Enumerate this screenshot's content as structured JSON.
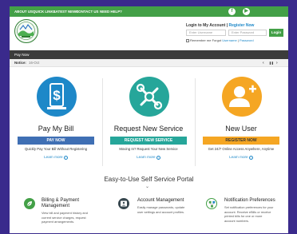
{
  "topnav": [
    "ABOUT US",
    "QUICK LINKS",
    "LATEST NEWS",
    "CONTACT US",
    "NEED HELP?"
  ],
  "social": [
    "f",
    "▶"
  ],
  "login": {
    "title": "Login to My Account",
    "sep": "|",
    "register": "Register Now",
    "username_placeholder": "Enter Username",
    "password_placeholder": "Enter Password",
    "button": "Login",
    "remember": "Remember me",
    "forgot_label": "Forgot",
    "forgot_username": "Username",
    "forgot_sep": "|",
    "forgot_password": "Password"
  },
  "paybar": "Pay Now",
  "notice": {
    "label": "Notice:",
    "date": "16-Oct",
    "prev": "‹",
    "pause": "❚❚",
    "next": "›"
  },
  "services": [
    {
      "title": "Pay My Bill",
      "button": "PAY NOW",
      "desc": "Quickly Pay Your Bill Without Registering",
      "learn": "Learn more"
    },
    {
      "title": "Request New Service",
      "button": "REQUEST NEW SERVICE",
      "desc": "Moving In? Request Your New Service",
      "learn": "Learn more"
    },
    {
      "title": "New User",
      "button": "REGISTER NOW",
      "desc": "Get 24/7 Online Access Anywhere, Anytime",
      "learn": "Learn more"
    }
  ],
  "portal_title": "Easy-to-Use Self Service Portal",
  "features": [
    {
      "title_line1": "Billing & Payment",
      "title_line2": "Management",
      "desc": [
        "View bill and payment history and",
        "current service charges, request",
        "payment arrangements."
      ]
    },
    {
      "title_line1": "Account Management",
      "title_line2": "",
      "desc": [
        "Easily manage passwords, update",
        "user settings and account profiles."
      ]
    },
    {
      "title_line1": "Notification Preferences",
      "title_line2": "",
      "desc": [
        "Set notification preferences for your",
        "account. Receive eBills or receive",
        "printed bills for one or more",
        "account numbers."
      ]
    }
  ],
  "colors": {
    "brand_green": "#43a047",
    "pay_blue": "#1e88c8",
    "teal": "#26a69a",
    "orange": "#f5a623",
    "dark_bar": "#3c3c3c",
    "outer_bg": "#3a2a8c"
  },
  "icons": {
    "pay": "dollar-sign-icon",
    "service": "tools-icon",
    "user": "add-user-icon",
    "billing": "leaf-icon",
    "account": "user-card-icon",
    "notify": "network-icon"
  }
}
